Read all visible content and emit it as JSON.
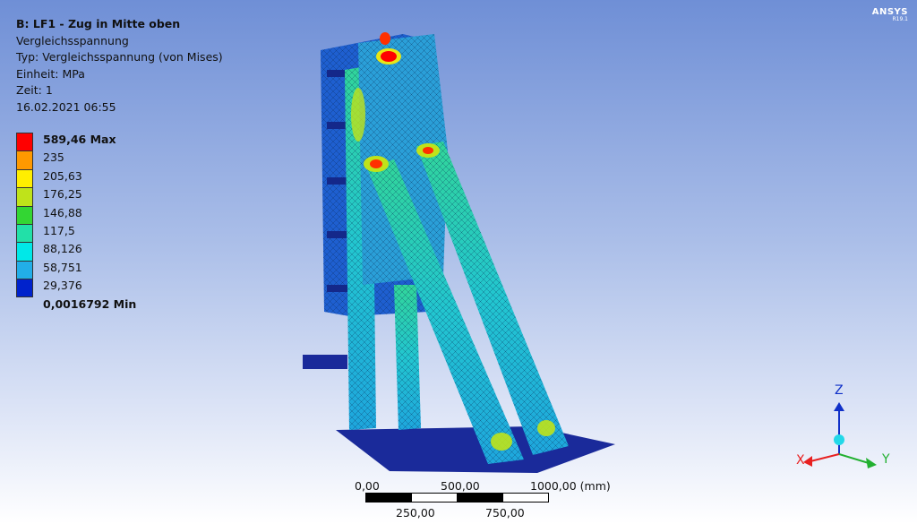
{
  "header": {
    "title": "B: LF1 - Zug in Mitte oben",
    "result": "Vergleichsspannung",
    "type": "Typ: Vergleichsspannung (von Mises)",
    "unit": "Einheit: MPa",
    "time": "Zeit: 1",
    "date": "16.02.2021 06:55"
  },
  "legend": {
    "labels": [
      "589,46 Max",
      "235",
      "205,63",
      "176,25",
      "146,88",
      "117,5",
      "88,126",
      "58,751",
      "29,376",
      "0,0016792 Min"
    ],
    "colors": [
      "#ff0000",
      "#ff9900",
      "#ffee00",
      "#bfe31a",
      "#33d633",
      "#22e0a8",
      "#00e8e8",
      "#22aee8",
      "#0022cc"
    ]
  },
  "logo": {
    "name": "ANSYS",
    "version": "R19.1"
  },
  "scale": {
    "top_labels": [
      "0,00",
      "500,00",
      "1000,00 (mm)"
    ],
    "bottom_labels": [
      "250,00",
      "750,00"
    ]
  },
  "triad": {
    "z": "Z",
    "x": "X",
    "y": "Y"
  },
  "colors": {
    "max": "#ff0000",
    "min": "#0022cc",
    "mesh_mid": "#2fc7c0",
    "base": "#1a2a9a"
  }
}
